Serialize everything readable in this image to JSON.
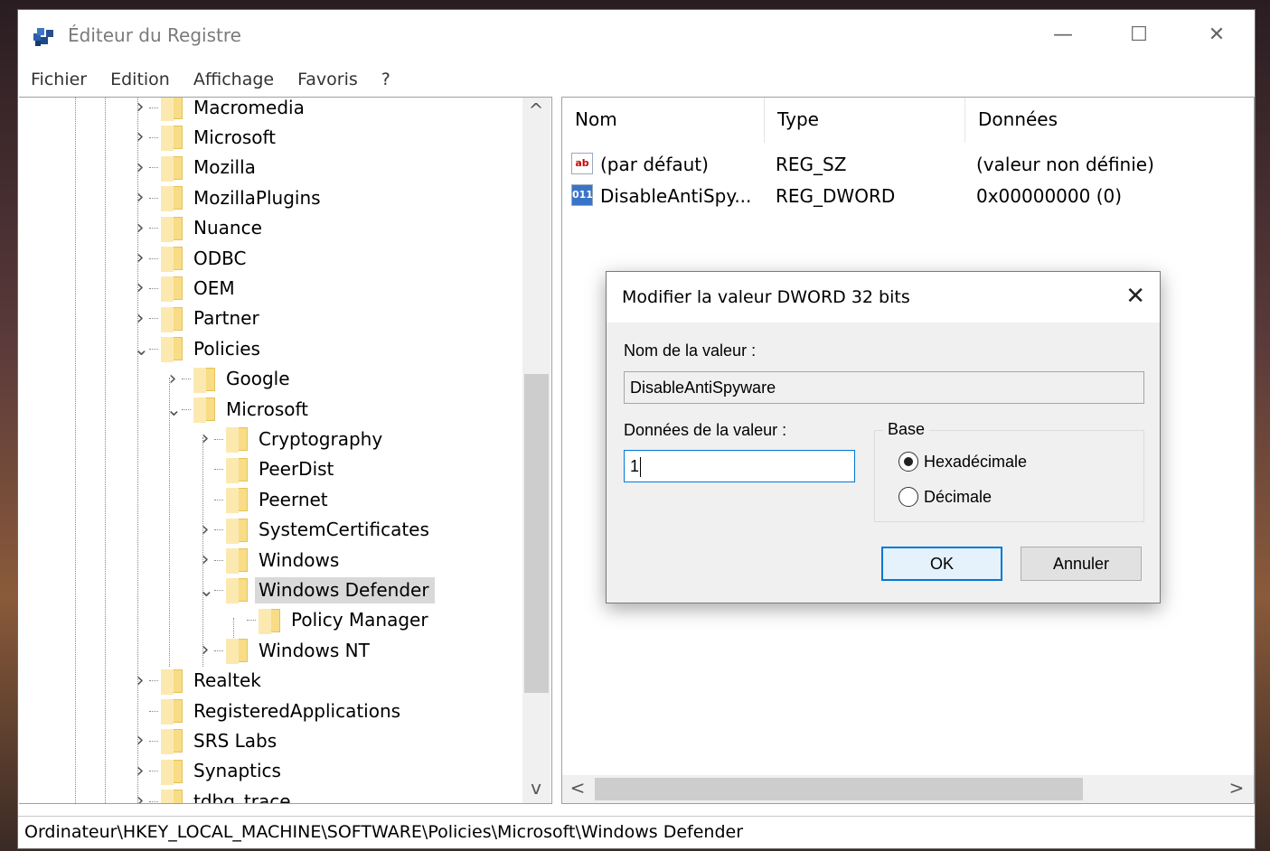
{
  "window": {
    "title": "Éditeur du Registre",
    "minimize": "—",
    "maximize": "☐",
    "close": "✕"
  },
  "menu": [
    "Fichier",
    "Edition",
    "Affichage",
    "Favoris",
    "?"
  ],
  "tree": [
    {
      "label": "Macromedia",
      "level": 0,
      "expander": "collapsed"
    },
    {
      "label": "Microsoft",
      "level": 0,
      "expander": "collapsed"
    },
    {
      "label": "Mozilla",
      "level": 0,
      "expander": "collapsed"
    },
    {
      "label": "MozillaPlugins",
      "level": 0,
      "expander": "collapsed"
    },
    {
      "label": "Nuance",
      "level": 0,
      "expander": "collapsed"
    },
    {
      "label": "ODBC",
      "level": 0,
      "expander": "collapsed"
    },
    {
      "label": "OEM",
      "level": 0,
      "expander": "collapsed"
    },
    {
      "label": "Partner",
      "level": 0,
      "expander": "collapsed"
    },
    {
      "label": "Policies",
      "level": 0,
      "expander": "expanded"
    },
    {
      "label": "Google",
      "level": 1,
      "expander": "collapsed"
    },
    {
      "label": "Microsoft",
      "level": 1,
      "expander": "expanded"
    },
    {
      "label": "Cryptography",
      "level": 2,
      "expander": "collapsed"
    },
    {
      "label": "PeerDist",
      "level": 2,
      "expander": "none"
    },
    {
      "label": "Peernet",
      "level": 2,
      "expander": "none"
    },
    {
      "label": "SystemCertificates",
      "level": 2,
      "expander": "collapsed"
    },
    {
      "label": "Windows",
      "level": 2,
      "expander": "collapsed"
    },
    {
      "label": "Windows Defender",
      "level": 2,
      "expander": "expanded",
      "selected": true
    },
    {
      "label": "Policy Manager",
      "level": 3,
      "expander": "none"
    },
    {
      "label": "Windows NT",
      "level": 2,
      "expander": "collapsed"
    },
    {
      "label": "Realtek",
      "level": 0,
      "expander": "collapsed"
    },
    {
      "label": "RegisteredApplications",
      "level": 0,
      "expander": "none"
    },
    {
      "label": "SRS Labs",
      "level": 0,
      "expander": "collapsed"
    },
    {
      "label": "Synaptics",
      "level": 0,
      "expander": "collapsed"
    },
    {
      "label": "tdbg_trace",
      "level": 0,
      "expander": "collapsed"
    }
  ],
  "list": {
    "columns": [
      "Nom",
      "Type",
      "Données"
    ],
    "rows": [
      {
        "icon": "string-value-icon",
        "icon_glyph": "ab",
        "name": "(par défaut)",
        "type": "REG_SZ",
        "data": "(valeur non définie)"
      },
      {
        "icon": "dword-value-icon",
        "icon_glyph": "011",
        "name": "DisableAntiSpy...",
        "type": "REG_DWORD",
        "data": "0x00000000 (0)"
      }
    ]
  },
  "scroll": {
    "up": "^",
    "down": "v",
    "left": "<",
    "right": ">"
  },
  "status": "Ordinateur\\HKEY_LOCAL_MACHINE\\SOFTWARE\\Policies\\Microsoft\\Windows Defender",
  "dialog": {
    "title": "Modifier la valeur DWORD 32 bits",
    "close": "✕",
    "name_label": "Nom de la valeur :",
    "name_value": "DisableAntiSpyware",
    "data_label": "Données de la valeur :",
    "data_value": "1",
    "base_label": "Base",
    "radio_hex": "Hexadécimale",
    "radio_dec": "Décimale",
    "selected_base": "hex",
    "ok": "OK",
    "cancel": "Annuler"
  }
}
